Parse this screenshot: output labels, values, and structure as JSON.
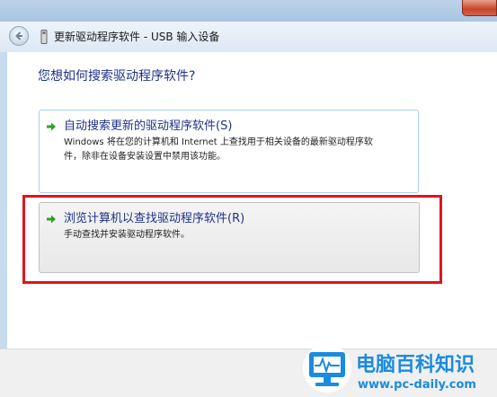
{
  "window": {
    "title": "更新驱动程序软件 - USB 输入设备"
  },
  "content": {
    "question": "您想如何搜索驱动程序软件?",
    "options": [
      {
        "title": "自动搜索更新的驱动程序软件(S)",
        "description_line1": "Windows 将在您的计算机和 Internet 上查找用于相关设备的最新驱动程序软",
        "description_line2": "件，除非在设备安装设置中禁用该功能。"
      },
      {
        "title": "浏览计算机以查找驱动程序软件(R)",
        "description_line1": "手动查找并安装驱动程序软件。"
      }
    ]
  },
  "watermark": {
    "title": "电脑百科知识",
    "url": "www.pc-daily.com"
  },
  "colors": {
    "link_blue": "#1e3287",
    "arrow_green": "#2aa12a",
    "highlight_red": "#e0141e",
    "watermark_blue": "#1a8be0"
  },
  "icons": {
    "back": "back-arrow-icon",
    "device": "usb-device-icon",
    "option_arrow": "green-arrow-icon",
    "watermark_logo": "monitor-heartbeat-logo"
  }
}
